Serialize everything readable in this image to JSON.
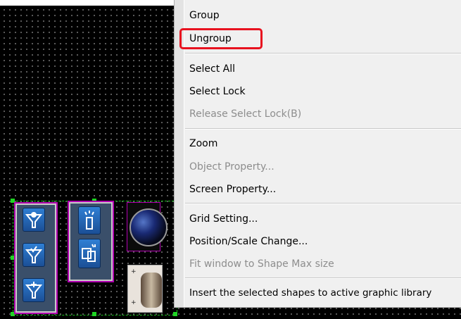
{
  "context_menu": {
    "items": [
      {
        "label": "Group",
        "enabled": true
      },
      {
        "label": "Ungroup",
        "enabled": true,
        "highlighted": true
      },
      {
        "label": "Select All",
        "enabled": true
      },
      {
        "label": "Select Lock",
        "enabled": true
      },
      {
        "label": "Release Select Lock(B)",
        "enabled": false
      },
      {
        "label": "Zoom",
        "enabled": true
      },
      {
        "label": "Object Property...",
        "enabled": false
      },
      {
        "label": "Screen Property...",
        "enabled": true
      },
      {
        "label": "Grid Setting...",
        "enabled": true
      },
      {
        "label": "Position/Scale Change...",
        "enabled": true
      },
      {
        "label": "Fit window to Shape Max size",
        "enabled": false
      },
      {
        "label": "Insert the selected shapes to active graphic library",
        "enabled": true
      }
    ]
  },
  "colors": {
    "highlight_border": "#e8121f",
    "selection": "#19c01e",
    "object_border": "#b100b1",
    "disabled_text": "#8d8d8d"
  },
  "canvas": {
    "icons": [
      "filter-valve-icon",
      "filter-check-icon",
      "filter-plus-icon",
      "lamp-switch-icon",
      "device-display-icon",
      "sphere-indicator-icon",
      "knob-icon"
    ]
  }
}
